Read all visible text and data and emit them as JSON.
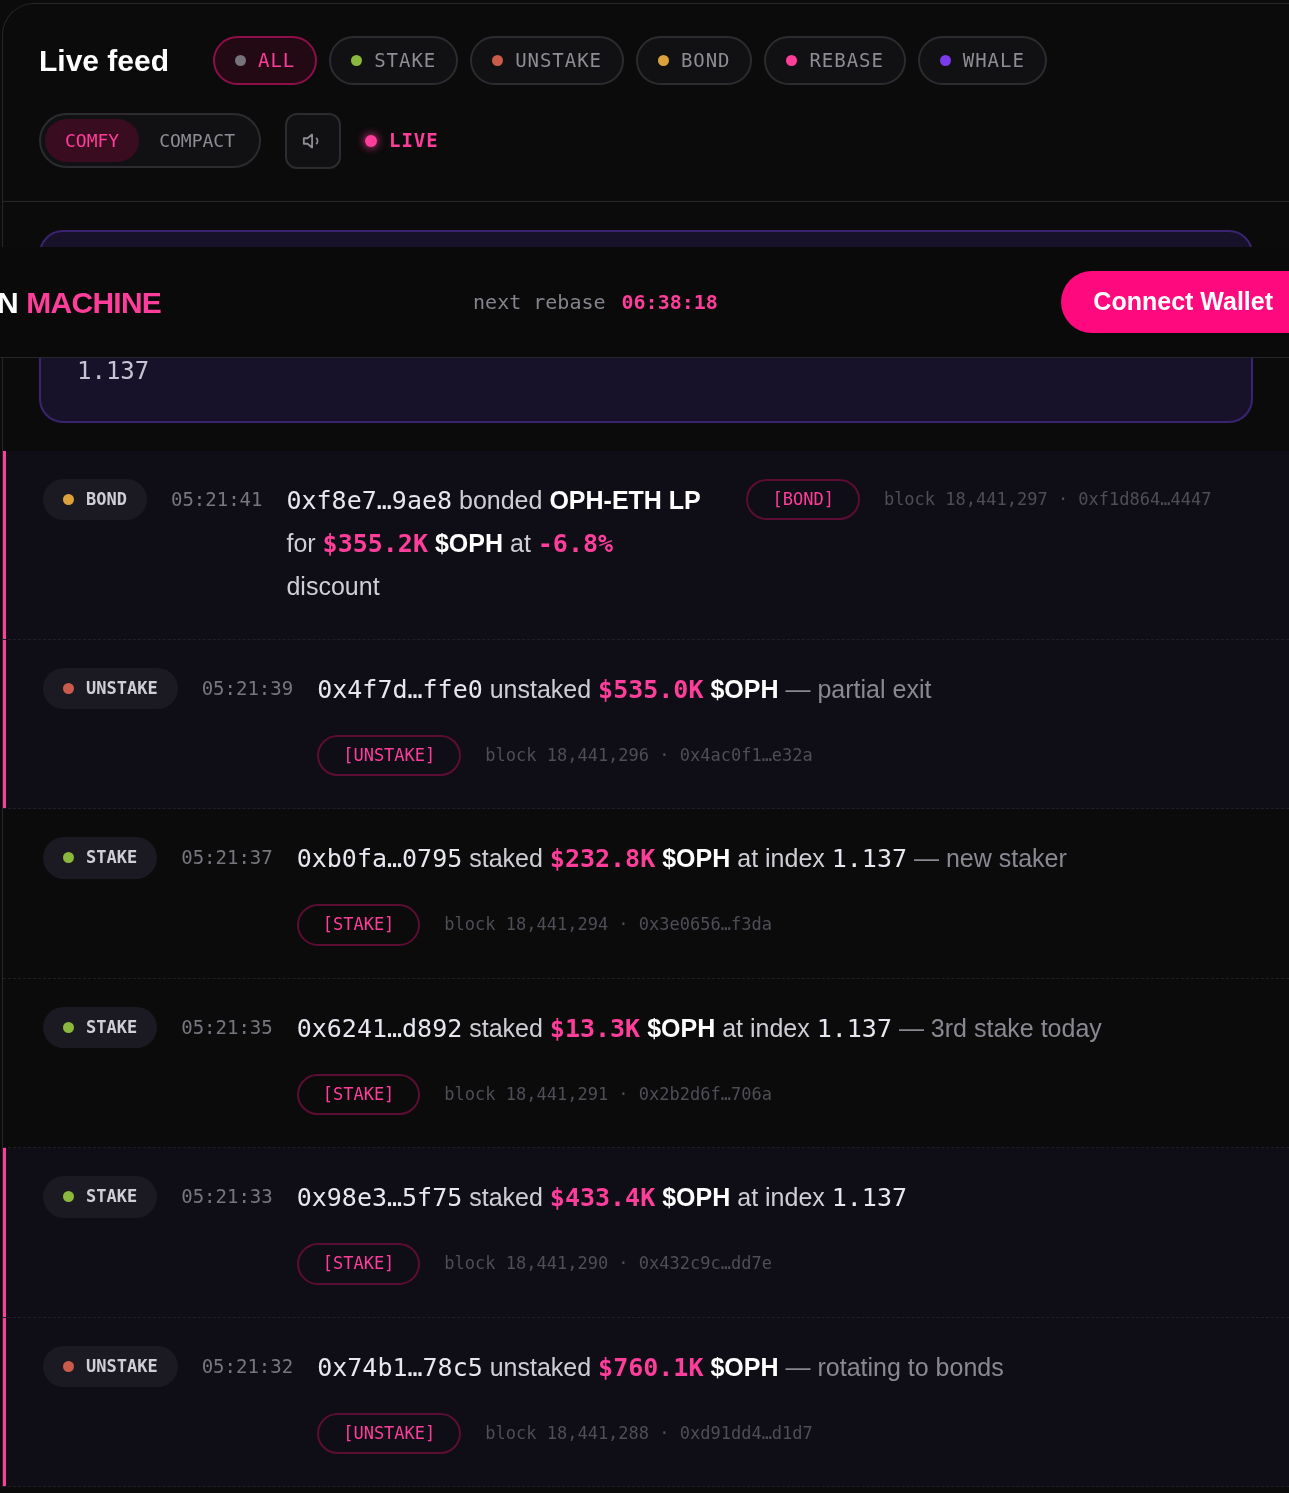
{
  "title": "Live feed",
  "filters": [
    {
      "label": "ALL",
      "color": "#77737a",
      "selected": true
    },
    {
      "label": "STAKE",
      "color": "#8ab83c",
      "selected": false
    },
    {
      "label": "UNSTAKE",
      "color": "#c95b4b",
      "selected": false
    },
    {
      "label": "BOND",
      "color": "#dba23c",
      "selected": false
    },
    {
      "label": "REBASE",
      "color": "#ff3d9a",
      "selected": false
    },
    {
      "label": "WHALE",
      "color": "#7c3aed",
      "selected": false
    }
  ],
  "density": [
    {
      "label": "COMFY",
      "selected": true
    },
    {
      "label": "COMPACT",
      "selected": false
    }
  ],
  "live": {
    "label": "LIVE",
    "on": true
  },
  "index_card": {
    "value": "1.137"
  },
  "topbar": {
    "brand": [
      {
        "text": "N",
        "accent": false
      },
      {
        "text": "MACHINE",
        "accent": true
      }
    ],
    "rebase_label": "next rebase",
    "rebase_time": "06:38:18",
    "button": "Connect Wallet"
  },
  "events": [
    {
      "type": "BOND",
      "color": "#dba23c",
      "time": "05:21:41",
      "kind": "inline",
      "highlighted": true,
      "parts": [
        {
          "kind": "addr",
          "text": "0xf8e7…9ae8"
        },
        {
          "kind": "text",
          "text": " bonded "
        },
        {
          "kind": "strong",
          "text": "OPH-ETH LP"
        },
        {
          "kind": "text",
          "text": " for "
        },
        {
          "kind": "amount",
          "text": "$355.2K"
        },
        {
          "kind": "strong",
          "text": "$OPH"
        },
        {
          "kind": "text",
          "text": " at "
        },
        {
          "kind": "amount",
          "text": "-6.8%"
        },
        {
          "kind": "text",
          "text": " discount"
        }
      ],
      "tag": "[BOND]",
      "meta": "block 18,441,297 · 0xf1d864…4447"
    },
    {
      "type": "UNSTAKE",
      "color": "#c95b4b",
      "time": "05:21:39",
      "kind": "stacked",
      "highlighted": true,
      "parts": [
        {
          "kind": "addr",
          "text": "0x4f7d…ffe0"
        },
        {
          "kind": "text",
          "text": " unstaked "
        },
        {
          "kind": "amount",
          "text": "$535.0K"
        },
        {
          "kind": "strong",
          "text": "$OPH"
        },
        {
          "kind": "muted",
          "text": " — partial exit"
        }
      ],
      "tag": "[UNSTAKE]",
      "meta": "block 18,441,296 · 0x4ac0f1…e32a"
    },
    {
      "type": "STAKE",
      "color": "#8ab83c",
      "time": "05:21:37",
      "kind": "stacked",
      "highlighted": false,
      "parts": [
        {
          "kind": "addr",
          "text": "0xb0fa…0795"
        },
        {
          "kind": "text",
          "text": " staked "
        },
        {
          "kind": "amount",
          "text": "$232.8K"
        },
        {
          "kind": "strong",
          "text": "$OPH"
        },
        {
          "kind": "text",
          "text": " at index "
        },
        {
          "kind": "num",
          "text": "1.137"
        },
        {
          "kind": "muted",
          "text": " — new staker"
        }
      ],
      "tag": "[STAKE]",
      "meta": "block 18,441,294 · 0x3e0656…f3da"
    },
    {
      "type": "STAKE",
      "color": "#8ab83c",
      "time": "05:21:35",
      "kind": "stacked",
      "highlighted": false,
      "parts": [
        {
          "kind": "addr",
          "text": "0x6241…d892"
        },
        {
          "kind": "text",
          "text": " staked "
        },
        {
          "kind": "amount",
          "text": "$13.3K"
        },
        {
          "kind": "strong",
          "text": "$OPH"
        },
        {
          "kind": "text",
          "text": " at index "
        },
        {
          "kind": "num",
          "text": "1.137"
        },
        {
          "kind": "muted",
          "text": " — 3rd stake today"
        }
      ],
      "tag": "[STAKE]",
      "meta": "block 18,441,291 · 0x2b2d6f…706a"
    },
    {
      "type": "STAKE",
      "color": "#8ab83c",
      "time": "05:21:33",
      "kind": "stacked",
      "highlighted": true,
      "parts": [
        {
          "kind": "addr",
          "text": "0x98e3…5f75"
        },
        {
          "kind": "text",
          "text": " staked "
        },
        {
          "kind": "amount",
          "text": "$433.4K"
        },
        {
          "kind": "strong",
          "text": "$OPH"
        },
        {
          "kind": "text",
          "text": " at index "
        },
        {
          "kind": "num",
          "text": "1.137"
        }
      ],
      "tag": "[STAKE]",
      "meta": "block 18,441,290 · 0x432c9c…dd7e"
    },
    {
      "type": "UNSTAKE",
      "color": "#c95b4b",
      "time": "05:21:32",
      "kind": "stacked",
      "highlighted": true,
      "parts": [
        {
          "kind": "addr",
          "text": "0x74b1…78c5"
        },
        {
          "kind": "text",
          "text": " unstaked "
        },
        {
          "kind": "amount",
          "text": "$760.1K"
        },
        {
          "kind": "strong",
          "text": "$OPH"
        },
        {
          "kind": "muted",
          "text": " — rotating to bonds"
        }
      ],
      "tag": "[UNSTAKE]",
      "meta": "block 18,441,288 · 0xd91dd4…d1d7"
    }
  ]
}
